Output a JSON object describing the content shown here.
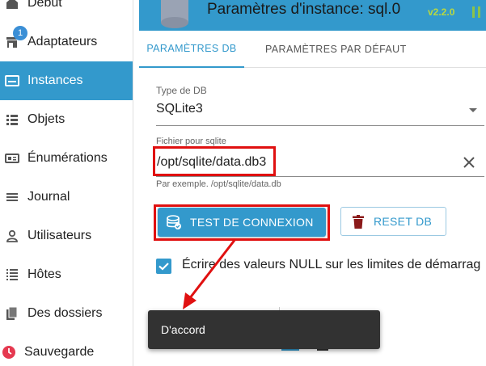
{
  "sidebar": {
    "items": [
      {
        "label": "Début",
        "icon": "home-icon"
      },
      {
        "label": "Adaptateurs",
        "icon": "store-icon",
        "badge": "1"
      },
      {
        "label": "Instances",
        "icon": "instances-icon",
        "active": true
      },
      {
        "label": "Objets",
        "icon": "list-icon"
      },
      {
        "label": "Énumérations",
        "icon": "enum-icon"
      },
      {
        "label": "Journal",
        "icon": "menu-icon"
      },
      {
        "label": "Utilisateurs",
        "icon": "person-icon"
      },
      {
        "label": "Hôtes",
        "icon": "hosts-icon"
      },
      {
        "label": "Des dossiers",
        "icon": "files-icon"
      },
      {
        "label": "Sauvegarde",
        "icon": "backup-icon"
      }
    ]
  },
  "header": {
    "title": "Paramètres d'instance: sql.0",
    "version": "v2.2.0"
  },
  "tabs": [
    {
      "label": "PARAMÈTRES DB",
      "active": true
    },
    {
      "label": "PARAMÈTRES PAR DÉFAUT",
      "active": false
    }
  ],
  "form": {
    "db_type_label": "Type de DB",
    "db_type_value": "SQLite3",
    "file_label": "Fichier pour sqlite",
    "file_value": "/opt/sqlite/data.db3",
    "file_helper": "Par exemple. /opt/sqlite/data.db",
    "test_button": "TEST DE CONNEXION",
    "reset_button": "RESET DB",
    "checkbox_label": "Écrire des valeurs NULL sur les limites de démarrag",
    "checkbox_checked": true
  },
  "snackbar": {
    "text": "D'accord"
  },
  "colors": {
    "accent": "#3399cc",
    "highlight": "#e01010",
    "snackbar_bg": "#323232",
    "reset_icon": "#8b1a1a"
  }
}
